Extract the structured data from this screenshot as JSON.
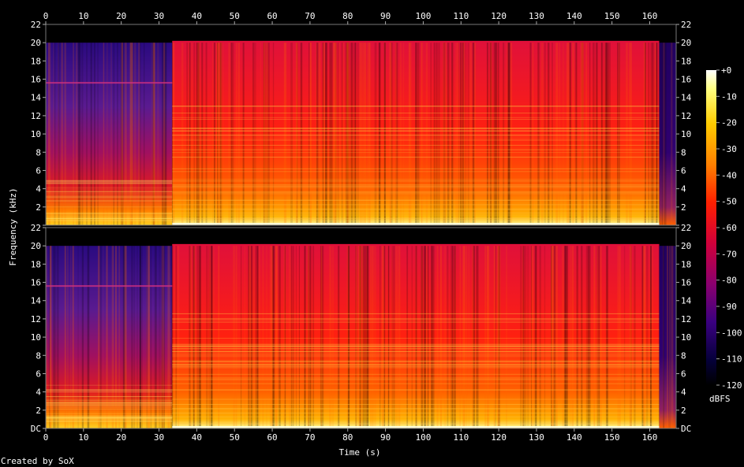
{
  "chart_data": {
    "type": "heatmap",
    "title": "",
    "xlabel": "Time (s)",
    "ylabel": "Frequency (kHz)",
    "xlim": [
      0,
      167
    ],
    "ylim_khz": [
      0,
      22
    ],
    "x_ticks": [
      "0",
      "10",
      "20",
      "30",
      "40",
      "50",
      "60",
      "70",
      "80",
      "90",
      "100",
      "110",
      "120",
      "130",
      "140",
      "150",
      "160"
    ],
    "y_ticks": [
      "DC",
      "2",
      "4",
      "6",
      "8",
      "10",
      "12",
      "14",
      "16",
      "18",
      "20",
      "22"
    ],
    "channels": 2,
    "colorbar": {
      "label": "dBFS",
      "ticks": [
        "+0",
        "-10",
        "-20",
        "-30",
        "-40",
        "-50",
        "-60",
        "-70",
        "-80",
        "-90",
        "-100",
        "-110",
        "-120"
      ],
      "range_db": [
        -120,
        0
      ],
      "colors": [
        "#ffffff",
        "#ffff66",
        "#ffcc00",
        "#ff8000",
        "#ff2000",
        "#d0003a",
        "#8a006e",
        "#3a0080",
        "#05003a",
        "#000000"
      ]
    },
    "segments_s": [
      {
        "from": 0,
        "to": 33.5,
        "level": "quiet, band-limited ~20 kHz"
      },
      {
        "from": 33.5,
        "to": 162.5,
        "level": "loud, band-limited 20 kHz"
      },
      {
        "from": 162.5,
        "to": 167,
        "level": "fade"
      }
    ],
    "footer": "Created by SoX"
  }
}
